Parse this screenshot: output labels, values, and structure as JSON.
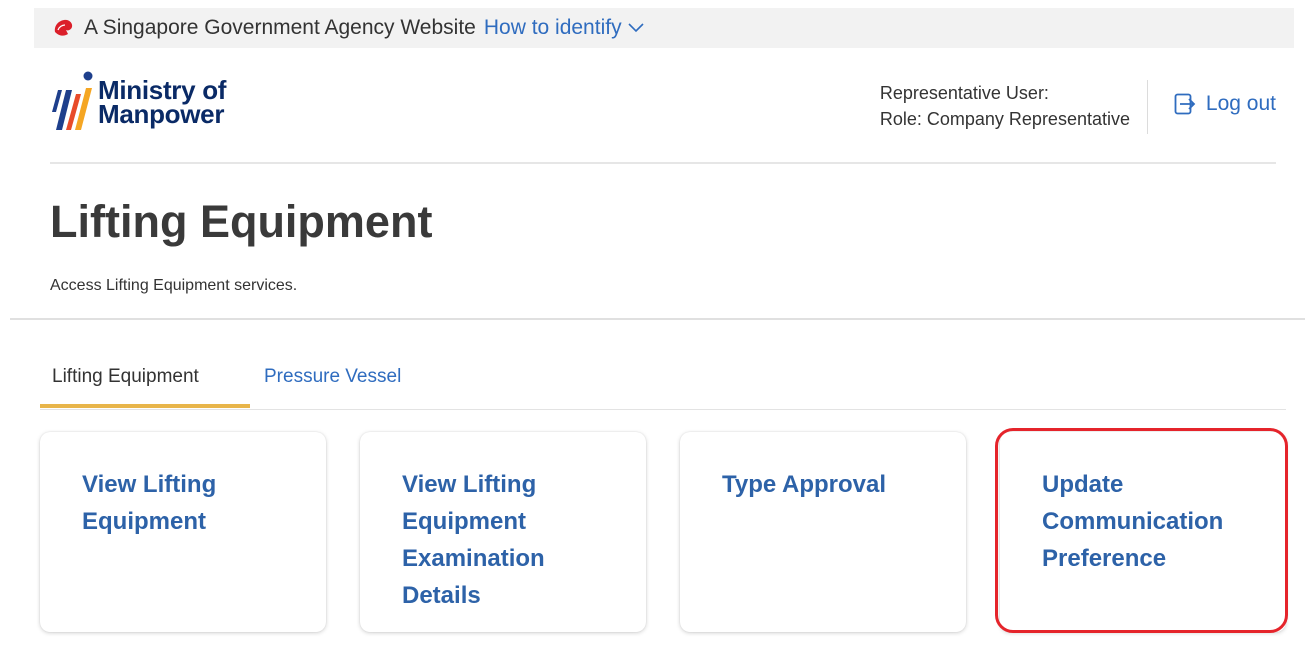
{
  "masthead": {
    "text": "A Singapore Government Agency Website",
    "link": "How to identify"
  },
  "logo": {
    "line1": "Ministry of",
    "line2": "Manpower"
  },
  "user": {
    "label": "Representative User:",
    "role": "Role: Company Representative"
  },
  "logout": "Log out",
  "page": {
    "title": "Lifting Equipment",
    "description": "Access Lifting Equipment services."
  },
  "tabs": [
    {
      "label": "Lifting Equipment",
      "active": true
    },
    {
      "label": "Pressure Vessel",
      "active": false
    }
  ],
  "cards": [
    {
      "title": "View Lifting Equipment"
    },
    {
      "title": "View Lifting Equipment Examination Details"
    },
    {
      "title": "Type Approval"
    },
    {
      "title": "Update Communication Preference"
    }
  ],
  "colors": {
    "link": "#2f6cbf",
    "card_title": "#2d62a8",
    "tab_underline": "#e8b54a",
    "highlight": "#e5242b"
  }
}
